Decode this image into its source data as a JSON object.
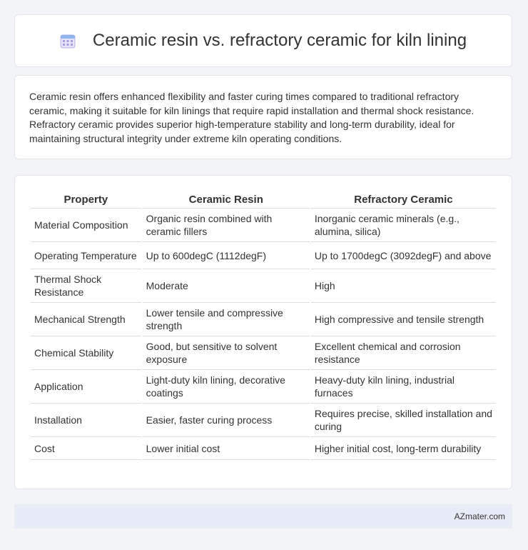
{
  "header": {
    "title": "Ceramic resin vs. refractory ceramic for kiln lining",
    "icon": "calendar-icon"
  },
  "summary": {
    "text": "Ceramic resin offers enhanced flexibility and faster curing times compared to traditional refractory ceramic, making it suitable for kiln linings that require rapid installation and thermal shock resistance. Refractory ceramic provides superior high-temperature stability and long-term durability, ideal for maintaining structural integrity under extreme kiln operating conditions."
  },
  "table": {
    "headers": [
      "Property",
      "Ceramic Resin",
      "Refractory Ceramic"
    ],
    "rows": [
      [
        "Material Composition",
        "Organic resin combined with ceramic fillers",
        "Inorganic ceramic minerals (e.g., alumina, silica)"
      ],
      [
        "Operating Temperature",
        "Up to 600degC (1112degF)",
        "Up to 1700degC (3092degF) and above"
      ],
      [
        "Thermal Shock Resistance",
        "Moderate",
        "High"
      ],
      [
        "Mechanical Strength",
        "Lower tensile and compressive strength",
        "High compressive and tensile strength"
      ],
      [
        "Chemical Stability",
        "Good, but sensitive to solvent exposure",
        "Excellent chemical and corrosion resistance"
      ],
      [
        "Application",
        "Light-duty kiln lining, decorative coatings",
        "Heavy-duty kiln lining, industrial furnaces"
      ],
      [
        "Installation",
        "Easier, faster curing process",
        "Requires precise, skilled installation and curing"
      ],
      [
        "Cost",
        "Lower initial cost",
        "Higher initial cost, long-term durability"
      ]
    ]
  },
  "footer": {
    "brand": "AZmater.com"
  }
}
